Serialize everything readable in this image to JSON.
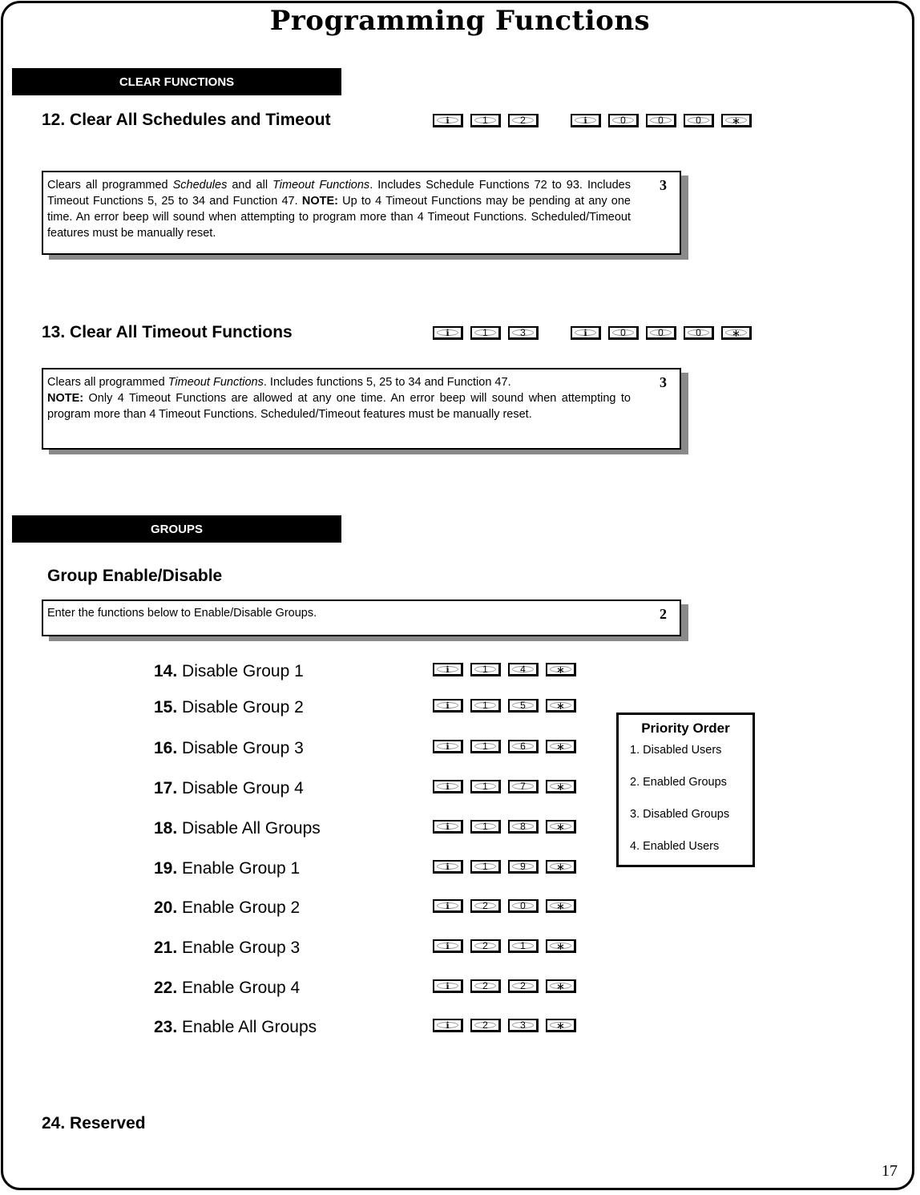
{
  "page": {
    "title": "Programming Functions",
    "page_number": "17"
  },
  "sections": {
    "clear_functions": {
      "label": "CLEAR FUNCTIONS",
      "functions": [
        {
          "heading": "12. Clear All Schedules and Timeout",
          "keys_part1": [
            "prog-icon",
            "1",
            "2"
          ],
          "keys_part2": [
            "prog-icon",
            "0",
            "0",
            "0",
            "*"
          ],
          "description_parts": {
            "p1": "Clears all programmed ",
            "i1": "Schedules",
            "p2": " and all ",
            "i2": "Timeout Functions",
            "p3": ". Includes Schedule Functions 72 to 93. Includes Timeout Functions 5, 25 to 34 and Function 47.  ",
            "b1": "NOTE:",
            "p4": "  Up to  4 Timeout  Functions may be pending at any one time.  An error beep will sound when attempting to program more than 4 Timeout Functions.  Scheduled/Timeout features must be manually reset."
          },
          "level": "3"
        },
        {
          "heading": "13. Clear All Timeout Functions",
          "keys_part1": [
            "prog-icon",
            "1",
            "3"
          ],
          "keys_part2": [
            "prog-icon",
            "0",
            "0",
            "0",
            "*"
          ],
          "description_parts": {
            "p1": "Clears all programmed ",
            "i1": "Timeout Functions",
            "p2": ". Includes functions 5, 25 to 34 and Function 47.",
            "b1": "NOTE:",
            "p3": "  Only 4 Timeout Functions are allowed at any one time.  An error beep will sound when attempting to program more than 4 Timeout Functions.  Scheduled/Timeout features must be manually reset."
          },
          "level": "3"
        }
      ]
    },
    "groups": {
      "label": "GROUPS",
      "heading": "Group Enable/Disable",
      "description": "Enter the functions below to Enable/Disable Groups.",
      "level": "2",
      "items": [
        {
          "num": "14.",
          "label": "Disable Group 1",
          "keys": [
            "prog-icon",
            "1",
            "4",
            "*"
          ]
        },
        {
          "num": "15.",
          "label": "Disable Group 2",
          "keys": [
            "prog-icon",
            "1",
            "5",
            "*"
          ]
        },
        {
          "num": "16.",
          "label": "Disable Group 3",
          "keys": [
            "prog-icon",
            "1",
            "6",
            "*"
          ]
        },
        {
          "num": "17.",
          "label": "Disable Group 4",
          "keys": [
            "prog-icon",
            "1",
            "7",
            "*"
          ]
        },
        {
          "num": "18.",
          "label": "Disable All Groups",
          "keys": [
            "prog-icon",
            "1",
            "8",
            "*"
          ]
        },
        {
          "num": "19.",
          "label": "Enable Group 1",
          "keys": [
            "prog-icon",
            "1",
            "9",
            "*"
          ]
        },
        {
          "num": "20.",
          "label": "Enable Group 2",
          "keys": [
            "prog-icon",
            "2",
            "0",
            "*"
          ]
        },
        {
          "num": "21.",
          "label": "Enable Group 3",
          "keys": [
            "prog-icon",
            "2",
            "1",
            "*"
          ]
        },
        {
          "num": "22.",
          "label": "Enable Group 4",
          "keys": [
            "prog-icon",
            "2",
            "2",
            "*"
          ]
        },
        {
          "num": "23.",
          "label": "Enable All Groups",
          "keys": [
            "prog-icon",
            "2",
            "3",
            "*"
          ]
        }
      ],
      "priority_order": {
        "title": "Priority Order",
        "items": [
          "1. Disabled Users",
          "2. Enabled Groups",
          "3. Disabled Groups",
          "4. Enabled Users"
        ]
      }
    },
    "reserved": {
      "heading": "24. Reserved"
    }
  }
}
